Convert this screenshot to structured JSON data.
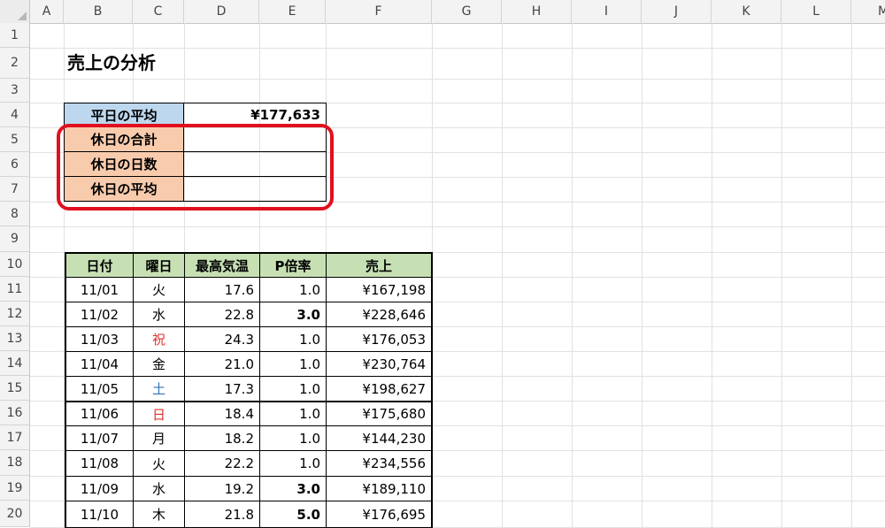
{
  "columns": [
    "A",
    "B",
    "C",
    "D",
    "E",
    "F",
    "G",
    "H",
    "I",
    "J",
    "K",
    "L",
    "M"
  ],
  "rows": [
    "1",
    "2",
    "3",
    "4",
    "5",
    "6",
    "7",
    "8",
    "9",
    "10",
    "11",
    "12",
    "13",
    "14",
    "15",
    "16",
    "17",
    "18",
    "19",
    "20"
  ],
  "title": "売上の分析",
  "summary": {
    "weekday_avg_label": "平日の平均",
    "weekday_avg_value": "¥177,633",
    "holiday_total_label": "休日の合計",
    "holiday_total_value": "",
    "holiday_days_label": "休日の日数",
    "holiday_days_value": "",
    "holiday_avg_label": "休日の平均",
    "holiday_avg_value": ""
  },
  "table": {
    "headers": [
      "日付",
      "曜日",
      "最高気温",
      "P倍率",
      "売上"
    ],
    "rows": [
      {
        "date": "11/01",
        "day": "火",
        "temp": "17.6",
        "p": "1.0",
        "sales": "¥167,198"
      },
      {
        "date": "11/02",
        "day": "水",
        "temp": "22.8",
        "p": "3.0",
        "sales": "¥228,646"
      },
      {
        "date": "11/03",
        "day": "祝",
        "temp": "24.3",
        "p": "1.0",
        "sales": "¥176,053"
      },
      {
        "date": "11/04",
        "day": "金",
        "temp": "21.0",
        "p": "1.0",
        "sales": "¥230,764"
      },
      {
        "date": "11/05",
        "day": "土",
        "temp": "17.3",
        "p": "1.0",
        "sales": "¥198,627"
      },
      {
        "date": "11/06",
        "day": "日",
        "temp": "18.4",
        "p": "1.0",
        "sales": "¥175,680"
      },
      {
        "date": "11/07",
        "day": "月",
        "temp": "18.2",
        "p": "1.0",
        "sales": "¥144,230"
      },
      {
        "date": "11/08",
        "day": "火",
        "temp": "22.2",
        "p": "1.0",
        "sales": "¥234,556"
      },
      {
        "date": "11/09",
        "day": "水",
        "temp": "19.2",
        "p": "3.0",
        "sales": "¥189,110"
      },
      {
        "date": "11/10",
        "day": "木",
        "temp": "21.8",
        "p": "5.0",
        "sales": "¥176,695"
      }
    ]
  },
  "colors": {
    "weekday_label_bg": "#bdd7ee",
    "holiday_label_bg": "#f8cbad",
    "header_bg": "#c6e0b4",
    "holiday_text": "#e03030",
    "saturday_text": "#2e75b6",
    "highlight_border": "#e0101e"
  }
}
